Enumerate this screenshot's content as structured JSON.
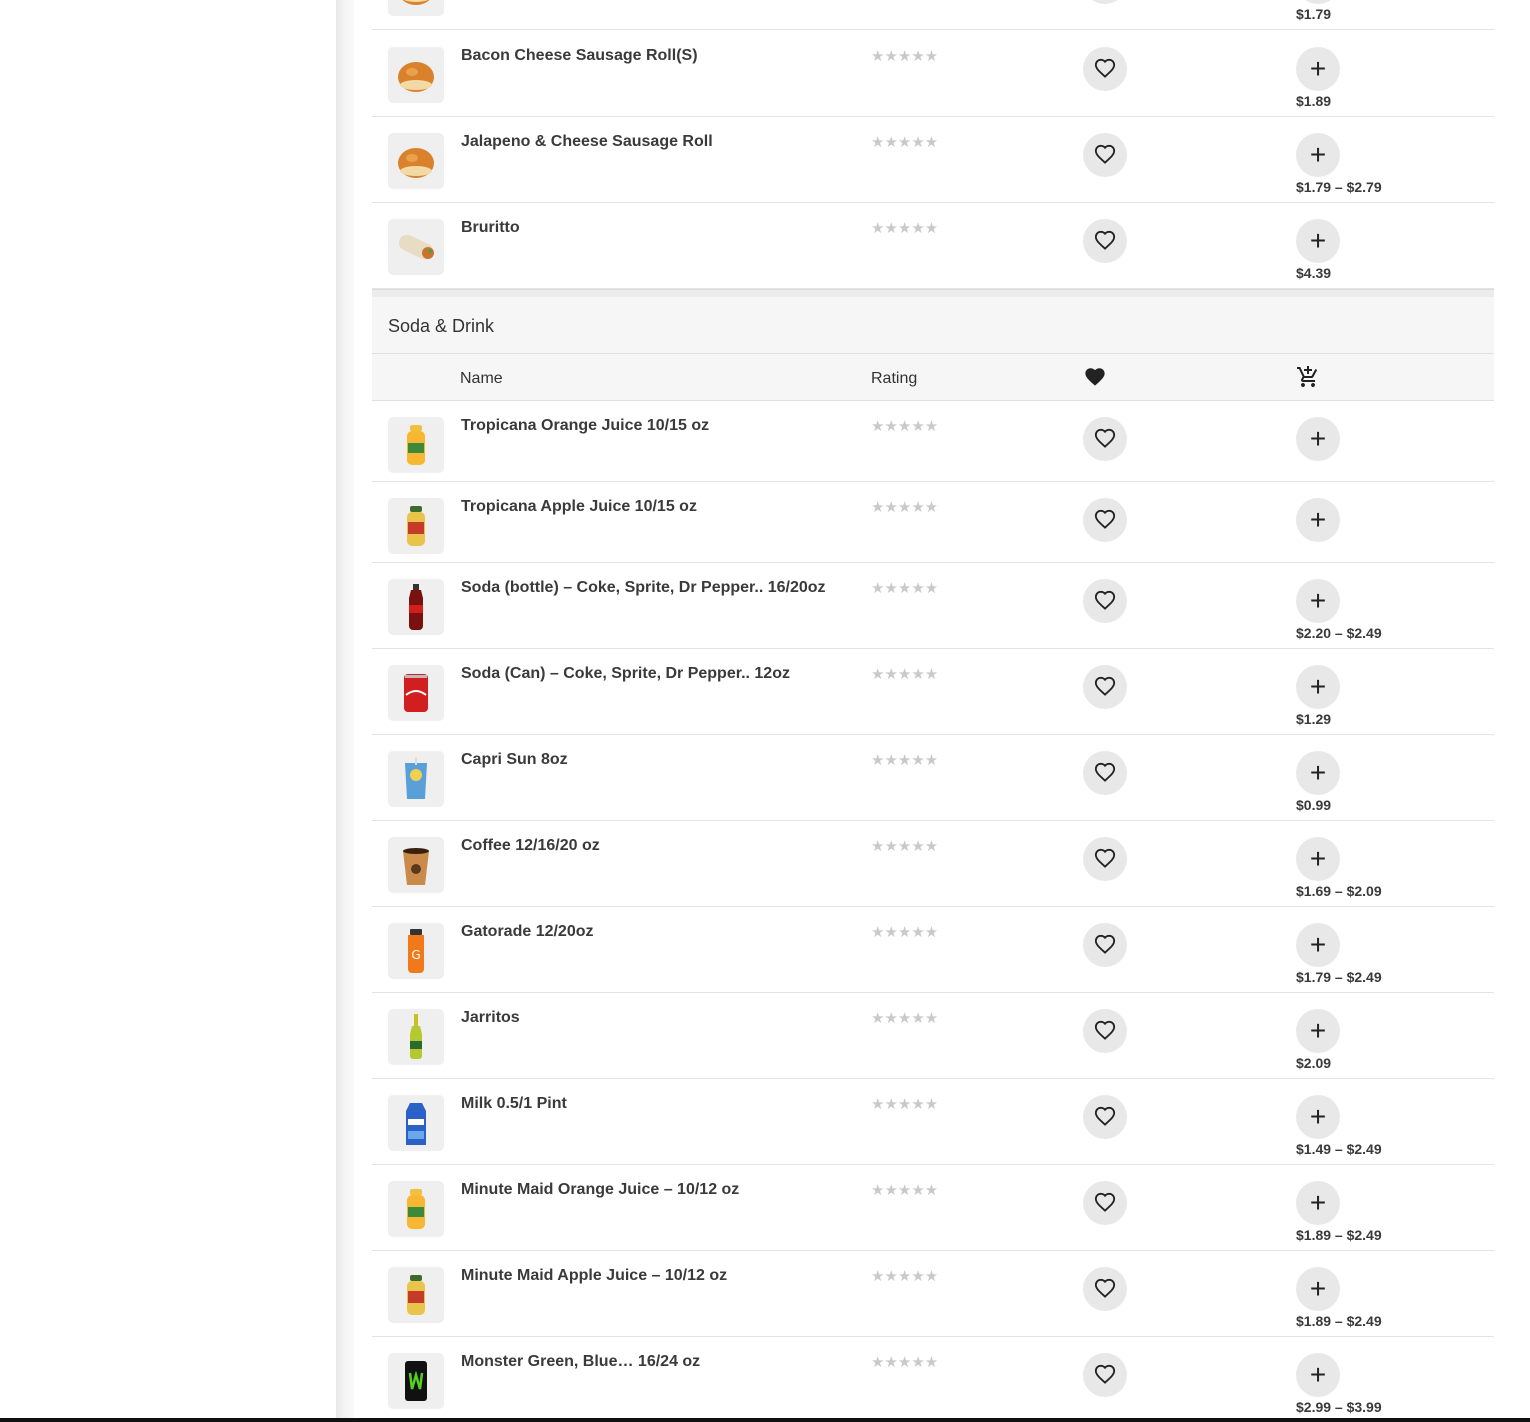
{
  "top_row": {
    "price": "$1.79"
  },
  "items_top": [
    {
      "name": "Bacon Cheese Sausage Roll(S)",
      "price": "$1.89",
      "icon": "kolache-roll"
    },
    {
      "name": "Jalapeno & Cheese Sausage Roll",
      "price": "$1.79 – $2.79",
      "icon": "kolache-roll"
    },
    {
      "name": "Bruritto",
      "price": "$4.39",
      "icon": "burrito"
    }
  ],
  "section": {
    "title": "Soda & Drink",
    "columns": {
      "name": "Name",
      "rating": "Rating"
    }
  },
  "rating_stars": "★★★★★",
  "add_symbol": "+",
  "drinks": [
    {
      "name": "Tropicana Orange Juice 10/15 oz",
      "price": "",
      "icon": "orange-juice-bottle"
    },
    {
      "name": "Tropicana Apple Juice 10/15 oz",
      "price": "",
      "icon": "apple-juice-bottle"
    },
    {
      "name": "Soda (bottle) – Coke, Sprite, Dr Pepper.. 16/20oz",
      "price": "$2.20 – $2.49",
      "icon": "soda-bottle"
    },
    {
      "name": "Soda (Can) – Coke, Sprite, Dr Pepper.. 12oz",
      "price": "$1.29",
      "icon": "soda-can"
    },
    {
      "name": "Capri Sun 8oz",
      "price": "$0.99",
      "icon": "juice-pouch"
    },
    {
      "name": "Coffee 12/16/20 oz",
      "price": "$1.69 – $2.09",
      "icon": "coffee-cup"
    },
    {
      "name": "Gatorade 12/20oz",
      "price": "$1.79 – $2.49",
      "icon": "sports-drink-bottle"
    },
    {
      "name": "Jarritos",
      "price": "$2.09",
      "icon": "glass-soda-bottle"
    },
    {
      "name": "Milk 0.5/1 Pint",
      "price": "$1.49 – $2.49",
      "icon": "milk-carton"
    },
    {
      "name": "Minute Maid Orange Juice – 10/12 oz",
      "price": "$1.89 – $2.49",
      "icon": "orange-juice-bottle"
    },
    {
      "name": "Minute Maid Apple Juice – 10/12 oz",
      "price": "$1.89 – $2.49",
      "icon": "apple-juice-bottle"
    },
    {
      "name": "Monster Green, Blue… 16/24 oz",
      "price": "$2.99 – $3.99",
      "icon": "energy-drink-can"
    }
  ],
  "colors": {
    "button_bg": "#e8e8e8",
    "section_bg": "#f6f6f6",
    "star": "#c9c9c9",
    "text": "#3a3a3a"
  }
}
